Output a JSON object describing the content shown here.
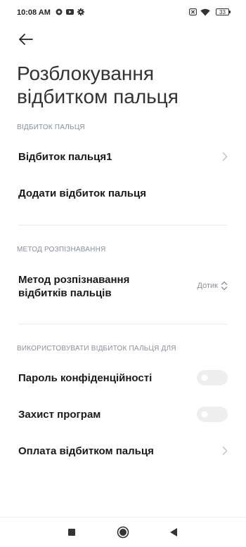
{
  "status_bar": {
    "time": "10:08 AM",
    "left_icons": [
      "at-sign-icon",
      "youtube-icon",
      "gear-icon"
    ],
    "right_icons": [
      "sim-none-icon",
      "wifi-icon"
    ],
    "battery_level": "33"
  },
  "header": {
    "title": "Розблокування відбитком пальця"
  },
  "sections": {
    "fingerprint": {
      "header": "ВІДБИТОК ПАЛЬЦЯ",
      "items": [
        {
          "label": "Відбиток пальця1"
        },
        {
          "label": "Додати відбиток пальця"
        }
      ]
    },
    "recognition": {
      "header": "МЕТОД РОЗПІЗНАВАННЯ",
      "method_label": "Метод розпізнавання відбитків пальців",
      "method_value": "Дотик"
    },
    "usage": {
      "header": "ВИКОРИСТОВУВАТИ ВІДБИТОК ПАЛЬЦЯ ДЛЯ",
      "items": [
        {
          "label": "Пароль конфіденційності",
          "toggle_on": false
        },
        {
          "label": "Захист програм",
          "toggle_on": false
        },
        {
          "label": "Оплата відбитком пальця"
        }
      ]
    }
  },
  "nav_bar": {
    "buttons": [
      "recents-square-icon",
      "home-circle-icon",
      "back-triangle-icon"
    ]
  },
  "colors": {
    "text": "#1a1a1a",
    "section_header": "#8a8f9a",
    "toggle_off": "#eeeeee",
    "divider": "#ececec"
  }
}
